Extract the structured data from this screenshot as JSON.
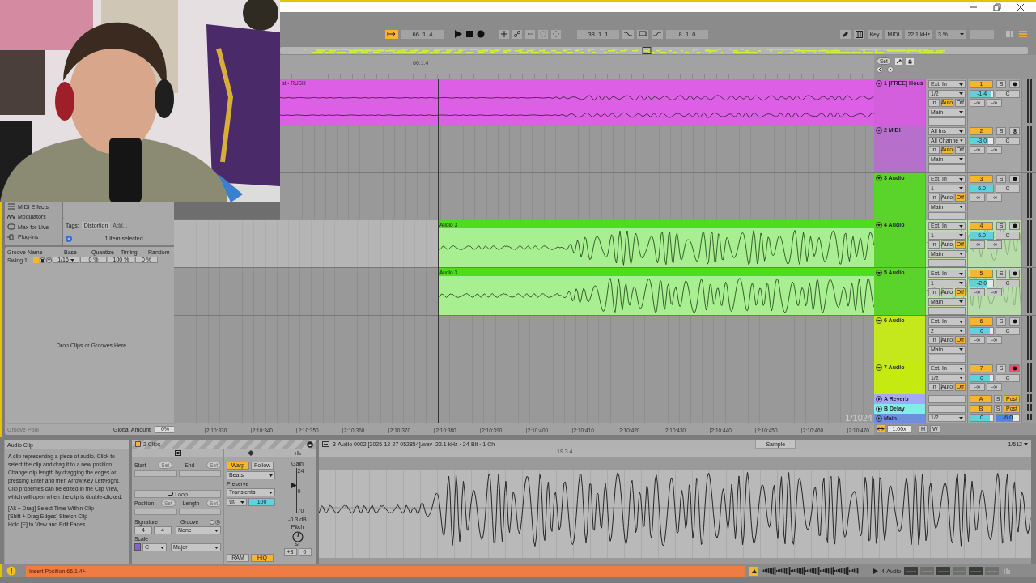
{
  "transport": {
    "follow": true,
    "position": "66. 1. 4",
    "loop_start": "38. 1. 1",
    "loop_length": "8. 1. 0",
    "key_label": "Key",
    "midi_label": "MIDI",
    "sample_rate": "22.1 kHz",
    "cpu_load": "3 %"
  },
  "browser": {
    "categories": [
      "MIDI Effects",
      "Modulators",
      "Max for Live",
      "Plug-ins"
    ],
    "tags_label": "Tags:",
    "tag": "Distortion",
    "tag_placeholder": "Add...",
    "selection_info": "1 item selected"
  },
  "groove_pool": {
    "columns": [
      "Groove Name",
      "Base",
      "Quantize",
      "Timing",
      "Random"
    ],
    "rows": [
      {
        "name": "Swing 1...",
        "base": "1/16",
        "quantize": "0 %",
        "timing": "100 %",
        "random": "0 %"
      }
    ],
    "drop_hint": "Drop Clips or Grooves Here",
    "title": "Groove Pool",
    "global_amount_label": "Global Amount",
    "global_amount": "0%"
  },
  "arrangement": {
    "beat_marker": "66.1.4",
    "set_label": "Set",
    "zoom": "1/1024",
    "time_labels": [
      "2:10:330",
      "2:10:340",
      "2:10:350",
      "2:10:360",
      "2:10:370",
      "2:10:380",
      "2:10:390",
      "2:10:400",
      "2:10:410",
      "2:10:420",
      "2:10:430",
      "2:10:440",
      "2:10:450",
      "2:10:460",
      "2:10:470"
    ]
  },
  "tracks": [
    {
      "kind": "audio",
      "name": "1 [FREE] Hous",
      "color": "#d35fdc",
      "expanded": true,
      "selected": false,
      "input": "Ext. In",
      "channel": "1/2",
      "monitor": [
        {
          "label": "In",
          "selected": false
        },
        {
          "label": "Auto",
          "selected": true
        },
        {
          "label": "Off",
          "selected": false
        }
      ],
      "output": "Main",
      "number": "1",
      "solo": "S",
      "armed": false,
      "volume": {
        "reading": "-1.4",
        "level": 0.88
      },
      "pan": "C",
      "sends": [
        "-∞",
        "-∞"
      ],
      "clip": {
        "name": "at - RUSH",
        "color": "#dd5fe6",
        "dragged": false
      }
    },
    {
      "kind": "midi",
      "name": "2 MIDI",
      "color": "#b76fcc",
      "expanded": true,
      "selected": false,
      "input": "All Ins",
      "channel": "All Channe",
      "monitor": [
        {
          "label": "In",
          "selected": false
        },
        {
          "label": "Auto",
          "selected": true
        },
        {
          "label": "Off",
          "selected": false
        }
      ],
      "output": "Main",
      "number": "2",
      "solo": "S",
      "armed": false,
      "volume": {
        "reading": "-3.0",
        "level": 0.78
      },
      "pan": "C",
      "sends": [
        "-∞",
        "-∞"
      ]
    },
    {
      "kind": "audio",
      "name": "3 Audio",
      "color": "#5ad42a",
      "expanded": true,
      "selected": false,
      "input": "Ext. In",
      "channel": "1",
      "monitor": [
        {
          "label": "In",
          "selected": false
        },
        {
          "label": "Auto",
          "selected": false
        },
        {
          "label": "Off",
          "selected": true
        }
      ],
      "output": "Main",
      "number": "3",
      "solo": "S",
      "armed": false,
      "volume": {
        "reading": "6.0",
        "level": 1
      },
      "pan": "C",
      "sends": [
        "-∞",
        "-∞"
      ]
    },
    {
      "kind": "audio",
      "name": "4 Audio",
      "color": "#5ad42a",
      "expanded": true,
      "selected": true,
      "input": "Ext. In",
      "channel": "1",
      "monitor": [
        {
          "label": "In",
          "selected": false
        },
        {
          "label": "Auto",
          "selected": false
        },
        {
          "label": "Off",
          "selected": true
        }
      ],
      "output": "Main",
      "number": "4",
      "solo": "S",
      "armed": false,
      "volume": {
        "reading": "6.0",
        "level": 1
      },
      "pan": "C",
      "sends": [
        "-∞",
        "-∞"
      ],
      "clip": {
        "name": "Audio 3",
        "color": "#4fdc1c",
        "dragged": true
      }
    },
    {
      "kind": "audio",
      "name": "5 Audio",
      "color": "#5ad42a",
      "expanded": true,
      "selected": false,
      "input": "Ext. In",
      "channel": "1",
      "monitor": [
        {
          "label": "In",
          "selected": false
        },
        {
          "label": "Auto",
          "selected": false
        },
        {
          "label": "Off",
          "selected": true
        }
      ],
      "output": "Main",
      "number": "5",
      "solo": "S",
      "armed": false,
      "volume": {
        "reading": "-2.0",
        "level": 0.75
      },
      "pan": "C",
      "sends": [
        "-∞",
        "-∞"
      ],
      "clip": {
        "name": "Audio 3",
        "color": "#4fdc1c",
        "dragged": true
      }
    },
    {
      "kind": "audio",
      "name": "6 Audio",
      "color": "#c5e81d",
      "expanded": true,
      "selected": false,
      "input": "Ext. In",
      "channel": "2",
      "monitor": [
        {
          "label": "In",
          "selected": false
        },
        {
          "label": "Auto",
          "selected": false
        },
        {
          "label": "Off",
          "selected": true
        }
      ],
      "output": "Main",
      "number": "6",
      "solo": "S",
      "armed": false,
      "volume": {
        "reading": "0",
        "level": 0.85
      },
      "pan": "C",
      "sends": [
        "-∞",
        "-∞"
      ]
    },
    {
      "kind": "audio",
      "name": "7 Audio",
      "color": "#c4ea12",
      "expanded": true,
      "selected": false,
      "input": "Ext. In",
      "channel": "1/2",
      "monitor": [
        {
          "label": "In",
          "selected": false
        },
        {
          "label": "Auto",
          "selected": false
        },
        {
          "label": "Off",
          "selected": true
        }
      ],
      "number": "7",
      "solo": "S",
      "armed": true,
      "volume": {
        "reading": "0",
        "level": 0.85
      },
      "pan": "C",
      "sends": [
        "-∞",
        "-∞"
      ]
    },
    {
      "kind": "return",
      "name": "A Reverb",
      "color": "#a3a9f2",
      "expanded": false,
      "selected": false,
      "number": "A",
      "solo": "S",
      "send_mode": "Post"
    },
    {
      "kind": "return",
      "name": "B Delay",
      "color": "#82ece9",
      "expanded": false,
      "selected": false,
      "number": "B",
      "solo": "S",
      "send_mode": "Post"
    },
    {
      "kind": "main",
      "name": "Main",
      "color": "#6d8fe0",
      "expanded": false,
      "selected": false,
      "channel": "1/2",
      "volume": {
        "reading": "0",
        "level": 0.85
      },
      "cue": {
        "reading": "-6.0",
        "level": 0.7
      }
    }
  ],
  "mixer_footer": {
    "tempo_factor": "1.00x",
    "h_label": "H",
    "w_label": "W"
  },
  "clip_info": {
    "title": "Audio Clip",
    "description": "A clip representing a piece of audio. Click to select the clip and drag it to a new position. Change clip length by dragging the edges or pressing Enter and then Arrow Key Left/Right. Clip properties can be edited in the Clip View, which will open when the clip is double-clicked.",
    "shortcuts": [
      "[Alt + Drag] Select Time Within Clip",
      "[Shift + Drag Edges] Stretch Clip",
      "Hold [F] to View and Edit Fades"
    ]
  },
  "clip_panel": {
    "title": "2 Clips",
    "start_label": "Start",
    "end_label": "End",
    "position_label": "Position",
    "length_label": "Length",
    "set_labels": [
      "Set",
      "Set",
      "Set",
      "Set"
    ],
    "loop_label": "Loop",
    "signature_label": "Signature",
    "signature": [
      "4",
      "4"
    ],
    "groove_label": "Groove",
    "groove": "None",
    "scale_label": "Scale",
    "scale_root": "C",
    "scale_mode": "Major",
    "warp": {
      "label": "Warp",
      "on": true
    },
    "follow": {
      "label": "Follow",
      "on": false
    },
    "warp_mode": "Beats",
    "preserve_label": "Preserve",
    "preserve": "Transients",
    "envelope": "100",
    "ram": {
      "label": "RAM",
      "on": false
    },
    "hiq": {
      "label": "HiQ",
      "on": true
    },
    "gain": {
      "label": "Gain",
      "ticks": [
        "24",
        "0",
        "70"
      ],
      "reading": "-0.3 dB",
      "level": 0.62
    },
    "pitch_label": "Pitch",
    "pitch_unit": "st",
    "transpose": "+3",
    "detune": "0"
  },
  "sample_editor": {
    "file": "3-Audio 0002 [2025-12-27 052854].wav",
    "format": "22.1 kHz · 24-Bit · 1 Ch",
    "tab": "Sample",
    "zoom": "1/512",
    "marker": "19.3.4"
  },
  "status_bar": {
    "message": "Insert Position:66.1.4+",
    "track": "4-Audio"
  }
}
